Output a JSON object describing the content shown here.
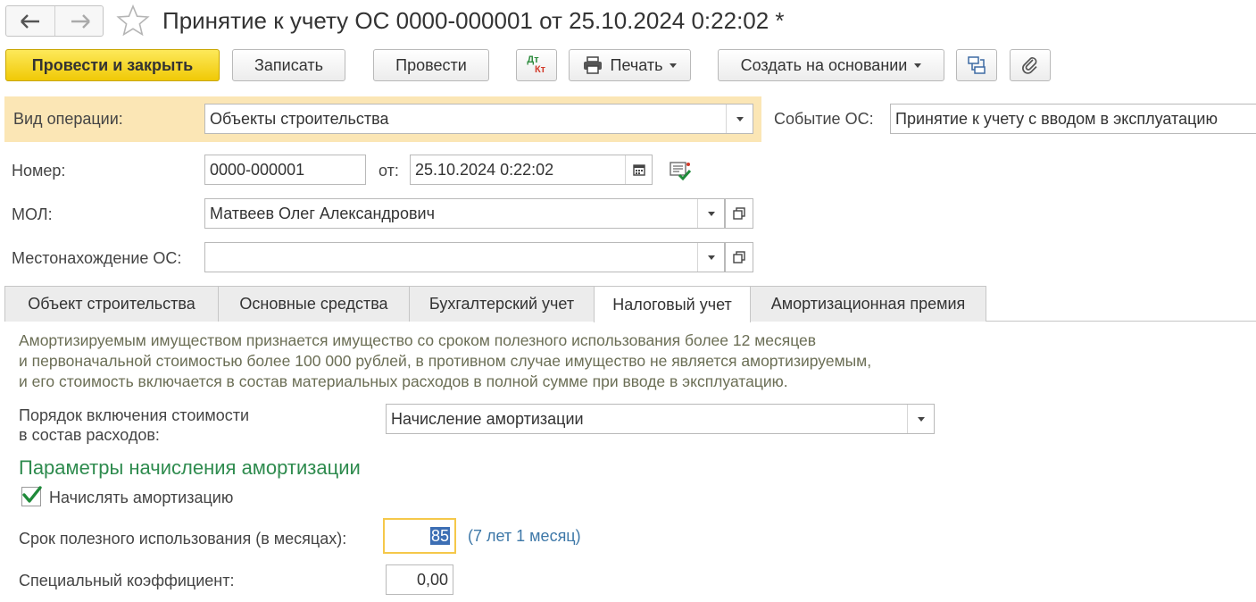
{
  "header": {
    "title": "Принятие к учету ОС 0000-000001 от 25.10.2024 0:22:02 *"
  },
  "toolbar": {
    "post_close": "Провести и закрыть",
    "save": "Записать",
    "post": "Провести",
    "dtkt_top": "Дт",
    "dtkt_bottom": "Кт",
    "print": "Печать",
    "create_based": "Создать на основании"
  },
  "form": {
    "operation_label": "Вид операции:",
    "operation_value": "Объекты строительства",
    "event_label": "Событие ОС:",
    "event_value": "Принятие к учету с вводом в эксплуатацию",
    "number_label": "Номер:",
    "number_value": "0000-000001",
    "date_label": "от:",
    "date_value": "25.10.2024  0:22:02",
    "mol_label": "МОЛ:",
    "mol_value": "Матвеев Олег Александрович",
    "location_label": "Местонахождение ОС:",
    "location_value": ""
  },
  "tabs": [
    {
      "label": "Объект строительства"
    },
    {
      "label": "Основные средства"
    },
    {
      "label": "Бухгалтерский учет"
    },
    {
      "label": "Налоговый учет"
    },
    {
      "label": "Амортизационная премия"
    }
  ],
  "tax": {
    "info_line1": "Амортизируемым имуществом признается имущество со сроком полезного использования более 12 месяцев",
    "info_line2": "и первоначальной стоимостью более 100 000 рублей, в противном случае имущество не является амортизируемым,",
    "info_line3": "и его стоимость включается в состав материальных расходов в полной сумме при вводе в эксплуатацию.",
    "order_label_line1": "Порядок включения стоимости",
    "order_label_line2": "в состав расходов:",
    "order_value": "Начисление амортизации",
    "section_title": "Параметры начисления амортизации",
    "accrue_label": "Начислять амортизацию",
    "accrue_checked": true,
    "useful_life_label": "Срок полезного использования (в месяцах):",
    "useful_life_value": "85",
    "useful_life_hint": "(7 лет 1 месяц)",
    "coef_label": "Специальный коэффициент:",
    "coef_value": "0,00"
  },
  "colors": {
    "primary_button": "#f5d31a",
    "highlight_row": "#fbe6b5",
    "section_title": "#2e8b4e",
    "hint": "#3e78a8",
    "checkmark": "#1f8a3a"
  }
}
